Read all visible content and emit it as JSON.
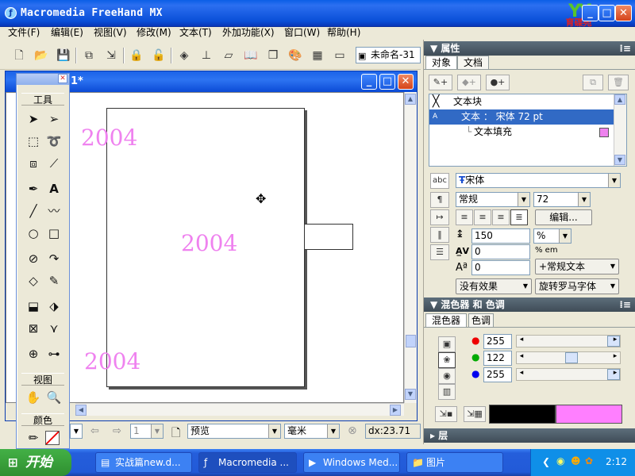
{
  "window": {
    "title": "Macromedia FreeHand MX",
    "minimize": "_",
    "maximize": "□",
    "close": "✕"
  },
  "logo": {
    "mark": "YY",
    "text": "育碟苑"
  },
  "menu": [
    "文件(F)",
    "编辑(E)",
    "视图(V)",
    "修改(M)",
    "文本(T)",
    "外加功能(X)",
    "窗口(W)",
    "帮助(H)"
  ],
  "toolbar": {
    "document_select": "未命名-31"
  },
  "document": {
    "title": "1*",
    "texts": [
      "2004",
      "2004",
      "2004"
    ]
  },
  "toolbox": {
    "section_tools": "工具",
    "section_view": "视图",
    "section_color": "颜色",
    "close": "✕"
  },
  "statusbar": {
    "page_num": "1",
    "preview_mode": "预览",
    "units": "毫米",
    "coords": "dx:23.71"
  },
  "properties": {
    "title": "属性",
    "tabs": [
      "对象",
      "文档"
    ],
    "tree": [
      {
        "label": "文本块"
      },
      {
        "label": "文本 ： 宋体 72 pt",
        "selected": true
      },
      {
        "label": "文本填充"
      }
    ],
    "fill_color": "#ee82ee",
    "font": "宋体",
    "style": "常规",
    "size": "72",
    "edit_button": "编辑...",
    "leading": "150",
    "leading_unit": "%",
    "kerning": "0",
    "kerning_unit": "% em",
    "baseline": "0",
    "baseline_mode": "+常规文本",
    "effect": "没有效果",
    "rotate": "旋转罗马字体",
    "abc_label": "abc"
  },
  "mixer": {
    "title": "混色器 和 色调",
    "tabs": [
      "混色器",
      "色调"
    ],
    "r": "255",
    "g": "122",
    "b": "255",
    "g_level": 0.48,
    "old_color": "#000000",
    "new_color": "#ff7fff"
  },
  "layers": {
    "title": "层"
  },
  "taskbar": {
    "start": "开始",
    "tasks": [
      "实战篇new.d...",
      "Macromedia ...",
      "Windows Med...",
      "图片"
    ],
    "time": "2:12"
  }
}
